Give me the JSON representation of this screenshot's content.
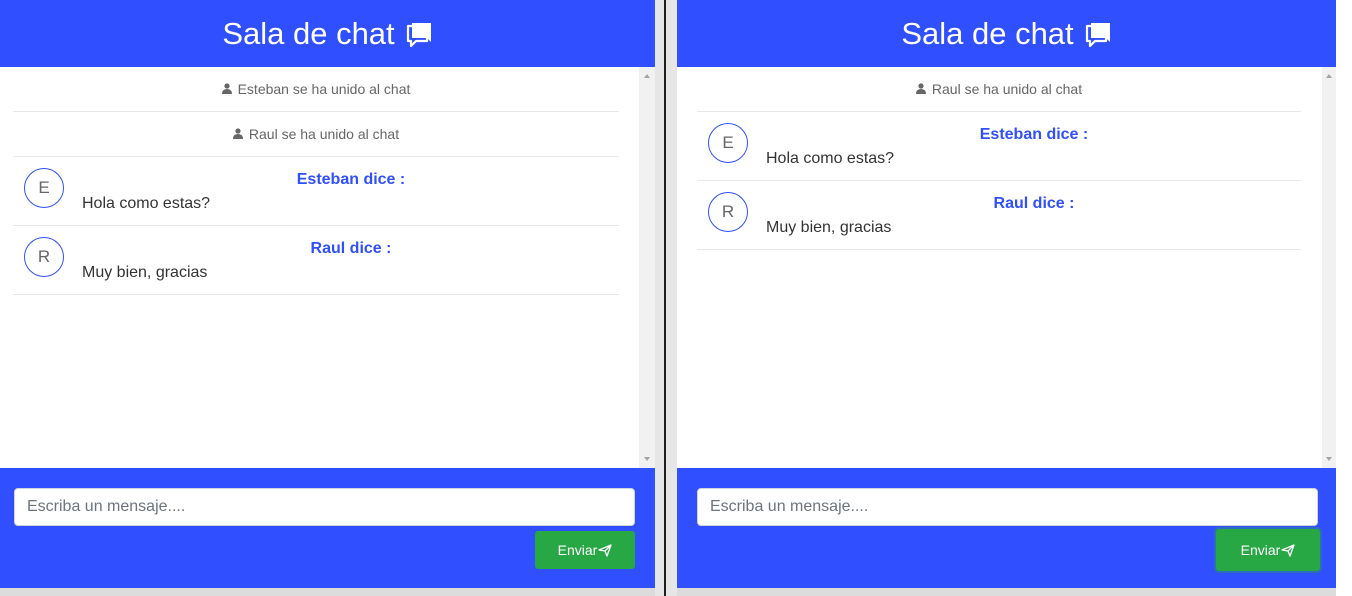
{
  "colors": {
    "primary": "#304ffe",
    "send_button": "#28a745",
    "muted_text": "#666666"
  },
  "panels": [
    {
      "header": {
        "title": "Sala de chat",
        "icon": "chat-bubbles-icon"
      },
      "system_messages": [
        {
          "text": "Esteban se ha unido al chat",
          "icon": "user-icon"
        },
        {
          "text": "Raul se ha unido al chat",
          "icon": "user-icon"
        }
      ],
      "messages": [
        {
          "initial": "E",
          "author": "Esteban dice :",
          "text": "Hola como estas?"
        },
        {
          "initial": "R",
          "author": "Raul dice :",
          "text": "Muy bien, gracias"
        }
      ],
      "input": {
        "placeholder": "Escriba un mensaje....",
        "value": ""
      },
      "send_button": {
        "label": "Enviar",
        "icon": "send-icon"
      }
    },
    {
      "header": {
        "title": "Sala de chat",
        "icon": "chat-bubbles-icon"
      },
      "system_messages": [
        {
          "text": "Raul se ha unido al chat",
          "icon": "user-icon"
        }
      ],
      "messages": [
        {
          "initial": "E",
          "author": "Esteban dice :",
          "text": "Hola como estas?"
        },
        {
          "initial": "R",
          "author": "Raul dice :",
          "text": "Muy bien, gracias"
        }
      ],
      "input": {
        "placeholder": "Escriba un mensaje....",
        "value": ""
      },
      "send_button": {
        "label": "Enviar",
        "icon": "send-icon"
      }
    }
  ]
}
